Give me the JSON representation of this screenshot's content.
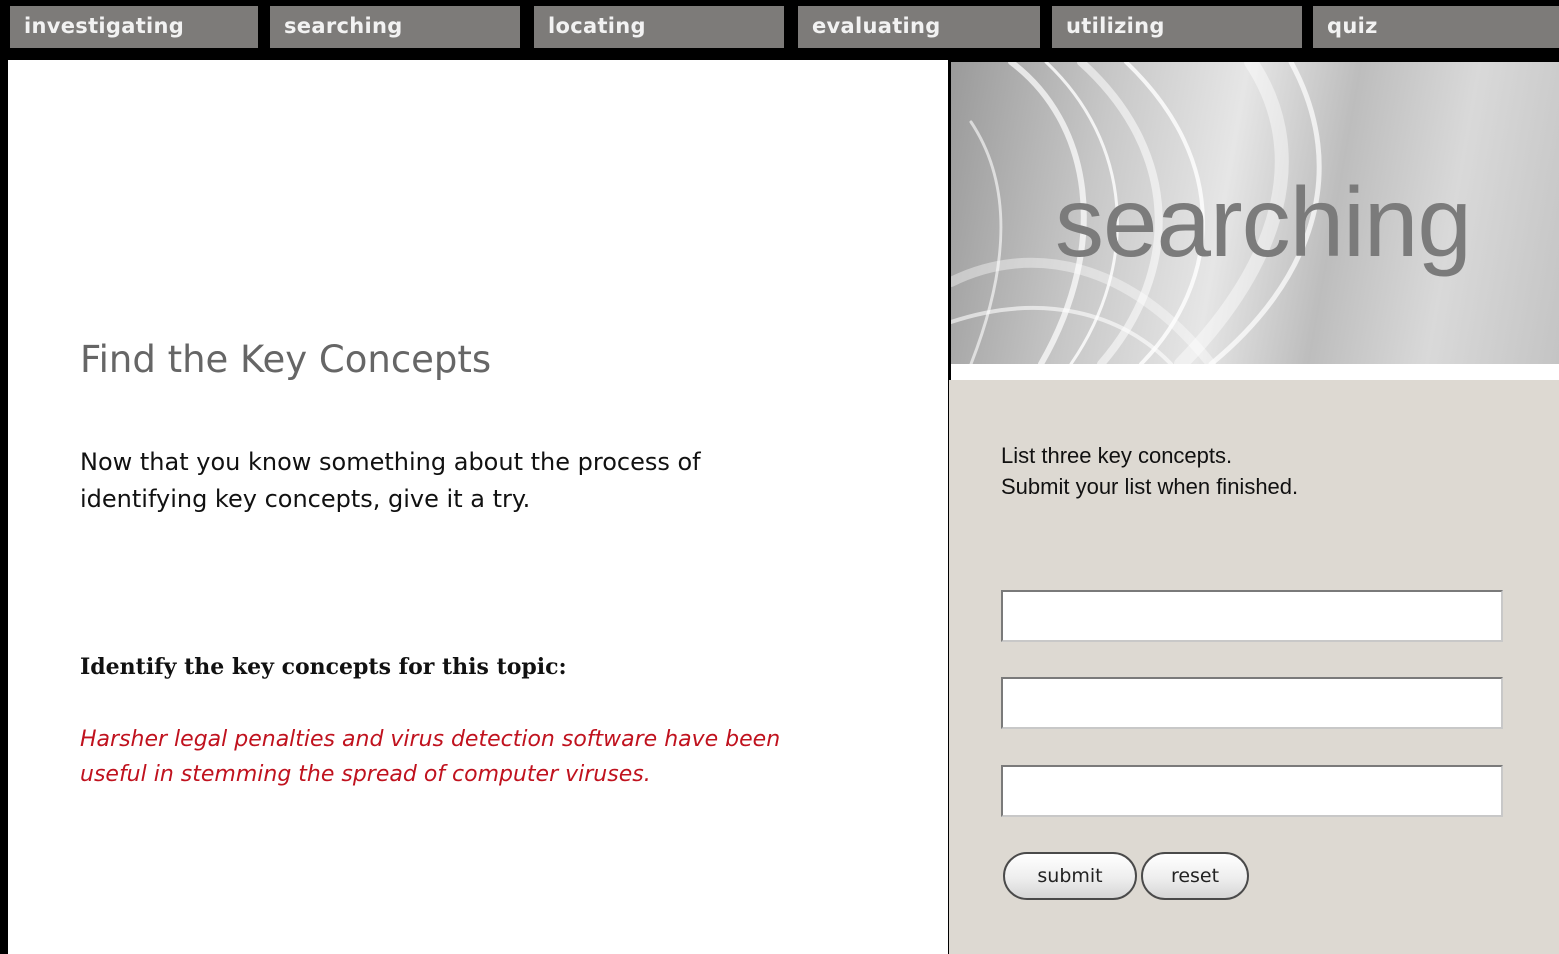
{
  "nav": {
    "tabs": [
      {
        "label": "investigating"
      },
      {
        "label": "searching"
      },
      {
        "label": "locating"
      },
      {
        "label": "evaluating"
      },
      {
        "label": "utilizing"
      },
      {
        "label": "quiz"
      }
    ]
  },
  "banner": {
    "title": "searching"
  },
  "main": {
    "title": "Find the Key Concepts",
    "intro_line1": "Now that you know something about the process of",
    "intro_line2": "identifying key concepts, give it a try.",
    "task_label": "Identify the key concepts for this topic:",
    "topic_line1": "Harsher legal penalties and virus detection software have been",
    "topic_line2": "useful in stemming the spread of computer viruses."
  },
  "form": {
    "instruction_line1": "List three key concepts.",
    "instruction_line2": "Submit your list when finished.",
    "concepts": [
      "",
      "",
      ""
    ],
    "submit_label": "submit",
    "reset_label": "reset"
  },
  "colors": {
    "nav_tab": "#7d7b79",
    "topic_text": "#c0121e",
    "form_panel": "#ddd9d2"
  }
}
